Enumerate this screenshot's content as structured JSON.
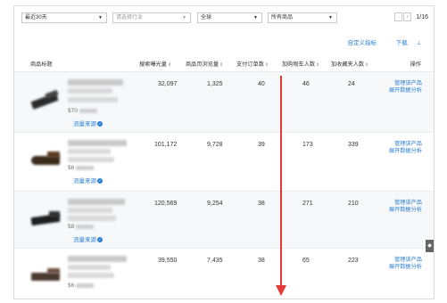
{
  "filters": {
    "period": "最近30天",
    "industry_placeholder": "请选择行业",
    "region": "全球",
    "product_scope": "所有商品"
  },
  "pager": {
    "prev": "‹",
    "next": "›",
    "count": "1/16"
  },
  "links": {
    "custom_metrics": "自定义指标",
    "download": "下载"
  },
  "icons": {
    "download": "download-icon",
    "verified": "verified-badge-icon",
    "caret": "caret-down-icon"
  },
  "table": {
    "headers": {
      "product": "商品标题",
      "search_exposure": "搜索曝光量",
      "page_views": "商品页浏览量",
      "paid_orders": "支付订单数",
      "add_to_cart": "加购物车人数",
      "favorites": "加收藏夹人数",
      "actions": "操作"
    },
    "rows": [
      {
        "price_prefix": "$70",
        "source": "流量来源",
        "search_exposure": "32,097",
        "page_views": "1,325",
        "paid_orders": "40",
        "add_to_cart": "46",
        "favorites": "24",
        "action1": "管理该产品",
        "action2": "展开数据分析"
      },
      {
        "price_prefix": "$6",
        "source": "流量来源",
        "search_exposure": "101,172",
        "page_views": "9,728",
        "paid_orders": "39",
        "add_to_cart": "173",
        "favorites": "339",
        "action1": "管理该产品",
        "action2": "展开数据分析"
      },
      {
        "price_prefix": "$8",
        "source": "流量来源",
        "search_exposure": "120,569",
        "page_views": "9,254",
        "paid_orders": "38",
        "add_to_cart": "271",
        "favorites": "210",
        "action1": "管理该产品",
        "action2": "展开数据分析"
      },
      {
        "price_prefix": "$6",
        "source": "",
        "search_exposure": "39,550",
        "page_views": "7,435",
        "paid_orders": "38",
        "add_to_cart": "65",
        "favorites": "223",
        "action1": "管理该产品",
        "action2": "展开数据分析"
      }
    ]
  },
  "colors": {
    "link": "#2d7fd1",
    "annotation_arrow": "#e53935",
    "row_alt": "#f7f8fa"
  }
}
